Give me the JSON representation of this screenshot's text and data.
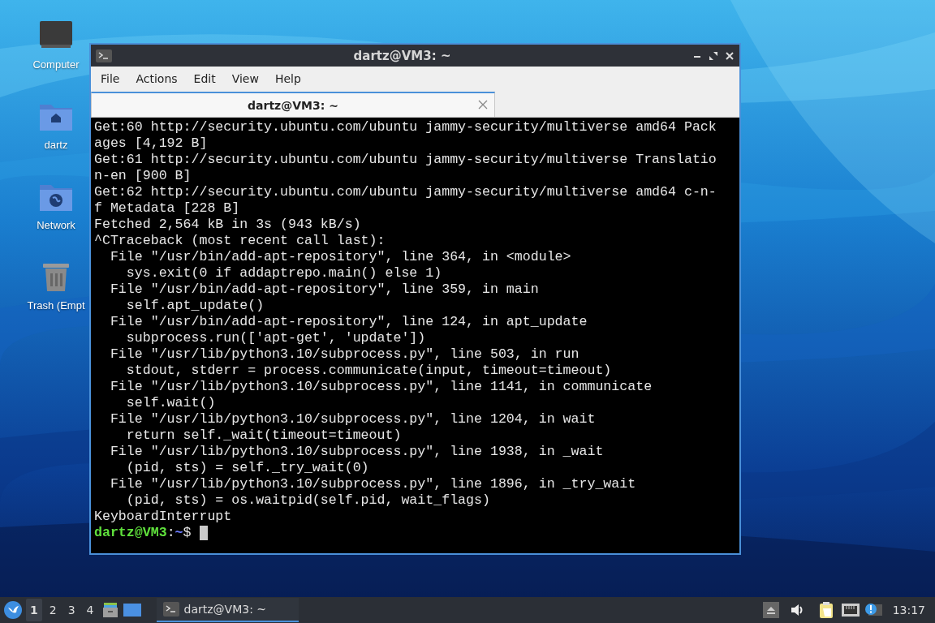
{
  "desktop_icons": [
    {
      "kind": "computer",
      "label": "Computer"
    },
    {
      "kind": "home",
      "label": "dartz"
    },
    {
      "kind": "network",
      "label": "Network"
    },
    {
      "kind": "trash",
      "label": "Trash (Empt"
    }
  ],
  "window": {
    "title": "dartz@VM3: ~",
    "menu": [
      "File",
      "Actions",
      "Edit",
      "View",
      "Help"
    ],
    "tabs": [
      {
        "label": "dartz@VM3: ~",
        "selected": true
      }
    ],
    "terminal": {
      "lines": [
        "Get:60 http://security.ubuntu.com/ubuntu jammy-security/multiverse amd64 Pack",
        "ages [4,192 B]",
        "Get:61 http://security.ubuntu.com/ubuntu jammy-security/multiverse Translatio",
        "n-en [900 B]",
        "Get:62 http://security.ubuntu.com/ubuntu jammy-security/multiverse amd64 c-n-",
        "f Metadata [228 B]",
        "Fetched 2,564 kB in 3s (943 kB/s)",
        "^CTraceback (most recent call last):",
        "  File \"/usr/bin/add-apt-repository\", line 364, in <module>",
        "    sys.exit(0 if addaptrepo.main() else 1)",
        "  File \"/usr/bin/add-apt-repository\", line 359, in main",
        "    self.apt_update()",
        "  File \"/usr/bin/add-apt-repository\", line 124, in apt_update",
        "    subprocess.run(['apt-get', 'update'])",
        "  File \"/usr/lib/python3.10/subprocess.py\", line 503, in run",
        "    stdout, stderr = process.communicate(input, timeout=timeout)",
        "  File \"/usr/lib/python3.10/subprocess.py\", line 1141, in communicate",
        "    self.wait()",
        "  File \"/usr/lib/python3.10/subprocess.py\", line 1204, in wait",
        "    return self._wait(timeout=timeout)",
        "  File \"/usr/lib/python3.10/subprocess.py\", line 1938, in _wait",
        "    (pid, sts) = self._try_wait(0)",
        "  File \"/usr/lib/python3.10/subprocess.py\", line 1896, in _try_wait",
        "    (pid, sts) = os.waitpid(self.pid, wait_flags)",
        "KeyboardInterrupt"
      ],
      "prompt": {
        "user": "dartz@VM3",
        "separator": ":",
        "path": "~",
        "symbol": "$"
      }
    }
  },
  "taskbar": {
    "workspaces": [
      {
        "label": "1",
        "selected": true
      },
      {
        "label": "2",
        "selected": false
      },
      {
        "label": "3",
        "selected": false
      },
      {
        "label": "4",
        "selected": false
      }
    ],
    "tasks": [
      {
        "label": "dartz@VM3: ~",
        "selected": true
      }
    ],
    "clock": "13:17"
  }
}
